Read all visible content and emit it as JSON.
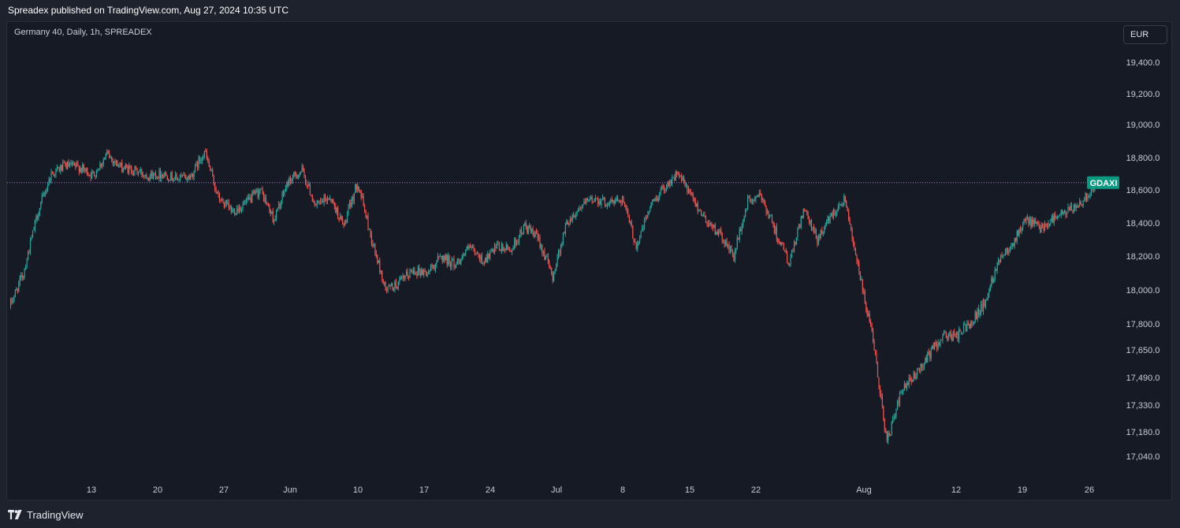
{
  "header": {
    "text": "Spreadex published on TradingView.com, Aug 27, 2024 10:35 UTC"
  },
  "chart_title": "Germany 40, Daily, 1h, SPREADEX",
  "currency_button": "EUR",
  "footer": {
    "brand": "TradingView"
  },
  "colors": {
    "up": "#26a69a",
    "down": "#ef5350",
    "price_line": "#a77cd9",
    "tag_bg": "#089981"
  },
  "chart_data": {
    "type": "candlestick",
    "symbol_tag": "GDAXI",
    "current_price": 18645,
    "y_ticks": [
      {
        "label": "19,400.0",
        "value": 19400
      },
      {
        "label": "19,200.0",
        "value": 19200
      },
      {
        "label": "19,000.0",
        "value": 19000
      },
      {
        "label": "18,800.0",
        "value": 18800
      },
      {
        "label": "18,600.0",
        "value": 18600
      },
      {
        "label": "18,400.0",
        "value": 18400
      },
      {
        "label": "18,200.0",
        "value": 18200
      },
      {
        "label": "18,000.0",
        "value": 18000
      },
      {
        "label": "17,800.0",
        "value": 17800
      },
      {
        "label": "17,650.0",
        "value": 17650
      },
      {
        "label": "17,490.0",
        "value": 17490
      },
      {
        "label": "17,330.0",
        "value": 17330
      },
      {
        "label": "17,180.0",
        "value": 17180
      },
      {
        "label": "17,040.0",
        "value": 17040
      }
    ],
    "x_ticks": [
      "13",
      "20",
      "27",
      "Jun",
      "10",
      "17",
      "24",
      "Jul",
      "8",
      "15",
      "22",
      "Aug",
      "12",
      "19",
      "26"
    ],
    "price_path": [
      [
        "May 8",
        17900
      ],
      [
        "May 9",
        18100
      ],
      [
        "May 10",
        18450
      ],
      [
        "May 13",
        18700
      ],
      [
        "May 14",
        18750
      ],
      [
        "May 15",
        18740
      ],
      [
        "May 16",
        18690
      ],
      [
        "May 17",
        18820
      ],
      [
        "May 20",
        18740
      ],
      [
        "May 21",
        18720
      ],
      [
        "May 22",
        18690
      ],
      [
        "May 23",
        18700
      ],
      [
        "May 24",
        18670
      ],
      [
        "May 27",
        18680
      ],
      [
        "May 28",
        18840
      ],
      [
        "May 29",
        18550
      ],
      [
        "May 30",
        18470
      ],
      [
        "May 31",
        18520
      ],
      [
        "Jun 3",
        18600
      ],
      [
        "Jun 4",
        18420
      ],
      [
        "Jun 5",
        18650
      ],
      [
        "Jun 6",
        18720
      ],
      [
        "Jun 7",
        18500
      ],
      [
        "Jun 10",
        18560
      ],
      [
        "Jun 11",
        18380
      ],
      [
        "Jun 12",
        18650
      ],
      [
        "Jun 13",
        18300
      ],
      [
        "Jun 14",
        18000
      ],
      [
        "Jun 17",
        18040
      ],
      [
        "Jun 18",
        18120
      ],
      [
        "Jun 19",
        18100
      ],
      [
        "Jun 20",
        18200
      ],
      [
        "Jun 21",
        18150
      ],
      [
        "Jun 24",
        18250
      ],
      [
        "Jun 25",
        18170
      ],
      [
        "Jun 26",
        18250
      ],
      [
        "Jun 27",
        18240
      ],
      [
        "Jun 28",
        18380
      ],
      [
        "Jul 1",
        18300
      ],
      [
        "Jul 2",
        18080
      ],
      [
        "Jul 3",
        18400
      ],
      [
        "Jul 4",
        18500
      ],
      [
        "Jul 5",
        18550
      ],
      [
        "Jul 8",
        18520
      ],
      [
        "Jul 9",
        18550
      ],
      [
        "Jul 10",
        18260
      ],
      [
        "Jul 11",
        18500
      ],
      [
        "Jul 12",
        18620
      ],
      [
        "Jul 15",
        18700
      ],
      [
        "Jul 16",
        18550
      ],
      [
        "Jul 17",
        18420
      ],
      [
        "Jul 18",
        18330
      ],
      [
        "Jul 19",
        18200
      ],
      [
        "Jul 22",
        18530
      ],
      [
        "Jul 23",
        18560
      ],
      [
        "Jul 24",
        18350
      ],
      [
        "Jul 25",
        18150
      ],
      [
        "Jul 26",
        18480
      ],
      [
        "Jul 29",
        18300
      ],
      [
        "Jul 30",
        18450
      ],
      [
        "Jul 31",
        18550
      ],
      [
        "Aug 1",
        18100
      ],
      [
        "Aug 2",
        17700
      ],
      [
        "Aug 5",
        17120
      ],
      [
        "Aug 6",
        17400
      ],
      [
        "Aug 7",
        17500
      ],
      [
        "Aug 8",
        17620
      ],
      [
        "Aug 9",
        17730
      ],
      [
        "Aug 12",
        17730
      ],
      [
        "Aug 13",
        17810
      ],
      [
        "Aug 14",
        17920
      ],
      [
        "Aug 15",
        18180
      ],
      [
        "Aug 16",
        18280
      ],
      [
        "Aug 19",
        18420
      ],
      [
        "Aug 20",
        18370
      ],
      [
        "Aug 21",
        18430
      ],
      [
        "Aug 22",
        18470
      ],
      [
        "Aug 23",
        18530
      ],
      [
        "Aug 26",
        18640
      ],
      [
        "Aug 27",
        18645
      ]
    ]
  }
}
